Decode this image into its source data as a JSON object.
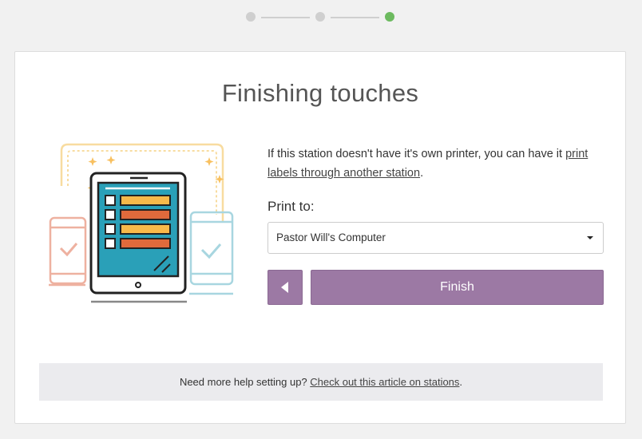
{
  "stepper": {
    "total_steps": 3,
    "current_step": 3,
    "active_color": "#6cba5f",
    "inactive_color": "#cfcfcf"
  },
  "title": "Finishing touches",
  "illustration": {
    "name": "tablet-and-phones-illustration"
  },
  "description": {
    "text": "If this station doesn't have it's own printer, you can have it ",
    "link_text": "print labels through another station",
    "suffix": "."
  },
  "print_to": {
    "label": "Print to:",
    "selected": "Pastor Will's Computer"
  },
  "buttons": {
    "back_icon": "back-arrow-icon",
    "finish_label": "Finish",
    "color": "#9c79a4"
  },
  "help": {
    "text": "Need more help setting up? ",
    "link_text": "Check out this article on stations",
    "suffix": "."
  }
}
